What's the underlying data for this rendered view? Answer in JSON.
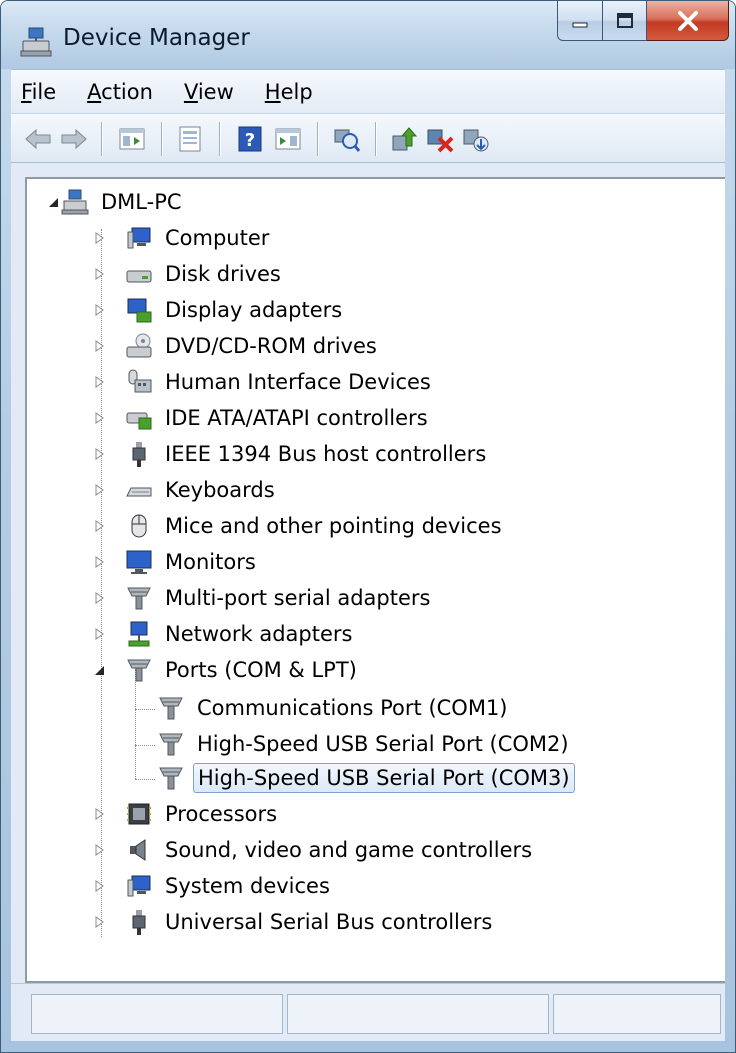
{
  "window": {
    "title": "Device Manager",
    "icon": "device-manager-icon"
  },
  "menu": [
    {
      "label_rest": "ile",
      "mnemonic": "F"
    },
    {
      "label_rest": "ction",
      "mnemonic": "A"
    },
    {
      "label_rest": "iew",
      "mnemonic": "V"
    },
    {
      "label_rest": "elp",
      "mnemonic": "H"
    }
  ],
  "toolbar": {
    "buttons": [
      "back-arrow-icon",
      "forward-arrow-icon",
      "show-hide-console-tree-icon",
      "properties-icon",
      "help-icon",
      "show-hide-action-pane-icon",
      "scan-hardware-icon",
      "update-driver-icon",
      "uninstall-icon",
      "disable-device-icon"
    ]
  },
  "tree": {
    "root": {
      "label": "DML-PC",
      "icon": "computer-network-icon",
      "expanded": true
    },
    "categories": [
      {
        "label": "Computer",
        "icon": "computer-icon",
        "expanded": false
      },
      {
        "label": "Disk drives",
        "icon": "disk-drive-icon",
        "expanded": false
      },
      {
        "label": "Display adapters",
        "icon": "display-adapter-icon",
        "expanded": false
      },
      {
        "label": "DVD/CD-ROM drives",
        "icon": "dvd-drive-icon",
        "expanded": false
      },
      {
        "label": "Human Interface Devices",
        "icon": "hid-icon",
        "expanded": false
      },
      {
        "label": "IDE ATA/ATAPI controllers",
        "icon": "ide-controller-icon",
        "expanded": false
      },
      {
        "label": "IEEE 1394 Bus host controllers",
        "icon": "ieee1394-plug-icon",
        "expanded": false
      },
      {
        "label": "Keyboards",
        "icon": "keyboard-icon",
        "expanded": false
      },
      {
        "label": "Mice and other pointing devices",
        "icon": "mouse-icon",
        "expanded": false
      },
      {
        "label": "Monitors",
        "icon": "monitor-icon",
        "expanded": false
      },
      {
        "label": "Multi-port serial adapters",
        "icon": "serial-port-icon",
        "expanded": false
      },
      {
        "label": "Network adapters",
        "icon": "network-adapter-icon",
        "expanded": false
      },
      {
        "label": "Ports (COM & LPT)",
        "icon": "port-icon",
        "expanded": true,
        "children": [
          {
            "label": "Communications Port (COM1)",
            "icon": "port-icon",
            "selected": false
          },
          {
            "label": "High-Speed USB Serial Port (COM2)",
            "icon": "port-icon",
            "selected": false
          },
          {
            "label": "High-Speed USB Serial Port (COM3)",
            "icon": "port-icon",
            "selected": true
          }
        ]
      },
      {
        "label": "Processors",
        "icon": "processor-icon",
        "expanded": false
      },
      {
        "label": "Sound, video and game controllers",
        "icon": "speaker-icon",
        "expanded": false
      },
      {
        "label": "System devices",
        "icon": "computer-icon",
        "expanded": false
      },
      {
        "label": "Universal Serial Bus controllers",
        "icon": "usb-plug-icon",
        "expanded": false
      }
    ]
  },
  "colors": {
    "selection_border": "#7da2ce",
    "close_button": "#c13a22",
    "titlebar": "#c4d9ec"
  }
}
